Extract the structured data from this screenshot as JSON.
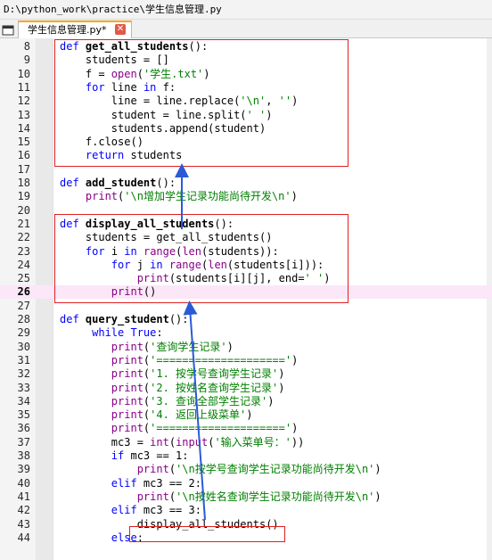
{
  "window": {
    "title": "D:\\python_work\\practice\\学生信息管理.py"
  },
  "tab": {
    "label": "学生信息管理.py*",
    "close_label": "✕"
  },
  "icons": {
    "tab_menu": "window-icon",
    "close": "close-icon"
  },
  "colors": {
    "keyword": "#0000ff",
    "builtin": "#880088",
    "string": "#008000",
    "annotation": "#e02020",
    "arrow": "#2a5bd7"
  },
  "lines": [
    {
      "n": "8",
      "tokens": [
        [
          "kw",
          "def "
        ],
        [
          "fn",
          "get_all_students"
        ],
        [
          "op",
          "():"
        ]
      ]
    },
    {
      "n": "9",
      "tokens": [
        [
          "op",
          "    students = []"
        ]
      ]
    },
    {
      "n": "10",
      "tokens": [
        [
          "op",
          "    f = "
        ],
        [
          "bi",
          "open"
        ],
        [
          "op",
          "("
        ],
        [
          "st",
          "'学生.txt'"
        ],
        [
          "op",
          ")"
        ]
      ]
    },
    {
      "n": "11",
      "tokens": [
        [
          "op",
          "    "
        ],
        [
          "kw",
          "for"
        ],
        [
          "op",
          " line "
        ],
        [
          "kw",
          "in"
        ],
        [
          "op",
          " f:"
        ]
      ]
    },
    {
      "n": "12",
      "tokens": [
        [
          "op",
          "        line = line.replace("
        ],
        [
          "st",
          "'\\n'"
        ],
        [
          "op",
          ", "
        ],
        [
          "st",
          "''"
        ],
        [
          "op",
          ")"
        ]
      ]
    },
    {
      "n": "13",
      "tokens": [
        [
          "op",
          "        student = line.split("
        ],
        [
          "st",
          "' '"
        ],
        [
          "op",
          ")"
        ]
      ]
    },
    {
      "n": "14",
      "tokens": [
        [
          "op",
          "        students.append(student)"
        ]
      ]
    },
    {
      "n": "15",
      "tokens": [
        [
          "op",
          "    f.close()"
        ]
      ]
    },
    {
      "n": "16",
      "tokens": [
        [
          "op",
          "    "
        ],
        [
          "kw",
          "return"
        ],
        [
          "op",
          " students"
        ]
      ]
    },
    {
      "n": "17",
      "tokens": []
    },
    {
      "n": "18",
      "tokens": [
        [
          "kw",
          "def "
        ],
        [
          "fn",
          "add_student"
        ],
        [
          "op",
          "():"
        ]
      ]
    },
    {
      "n": "19",
      "tokens": [
        [
          "op",
          "    "
        ],
        [
          "bi",
          "print"
        ],
        [
          "op",
          "("
        ],
        [
          "st",
          "'\\n增加学生记录功能尚待开发\\n'"
        ],
        [
          "op",
          ")"
        ]
      ]
    },
    {
      "n": "20",
      "tokens": []
    },
    {
      "n": "21",
      "tokens": [
        [
          "kw",
          "def "
        ],
        [
          "fn",
          "display_all_students"
        ],
        [
          "op",
          "():"
        ]
      ]
    },
    {
      "n": "22",
      "tokens": [
        [
          "op",
          "    students = get_all_students()"
        ]
      ]
    },
    {
      "n": "23",
      "tokens": [
        [
          "op",
          "    "
        ],
        [
          "kw",
          "for"
        ],
        [
          "op",
          " i "
        ],
        [
          "kw",
          "in"
        ],
        [
          "op",
          " "
        ],
        [
          "bi",
          "range"
        ],
        [
          "op",
          "("
        ],
        [
          "bi",
          "len"
        ],
        [
          "op",
          "(students)):"
        ]
      ]
    },
    {
      "n": "24",
      "tokens": [
        [
          "op",
          "        "
        ],
        [
          "kw",
          "for"
        ],
        [
          "op",
          " j "
        ],
        [
          "kw",
          "in"
        ],
        [
          "op",
          " "
        ],
        [
          "bi",
          "range"
        ],
        [
          "op",
          "("
        ],
        [
          "bi",
          "len"
        ],
        [
          "op",
          "(students[i])):"
        ]
      ]
    },
    {
      "n": "25",
      "tokens": [
        [
          "op",
          "            "
        ],
        [
          "bi",
          "print"
        ],
        [
          "op",
          "(students[i][j], end="
        ],
        [
          "st",
          "' '"
        ],
        [
          "op",
          ")"
        ]
      ]
    },
    {
      "n": "26",
      "current": true,
      "tokens": [
        [
          "op",
          "        "
        ],
        [
          "bi",
          "print"
        ],
        [
          "op",
          "()"
        ]
      ]
    },
    {
      "n": "27",
      "tokens": []
    },
    {
      "n": "28",
      "tokens": [
        [
          "kw",
          "def "
        ],
        [
          "fn",
          "query_student"
        ],
        [
          "op",
          "():"
        ]
      ]
    },
    {
      "n": "29",
      "tokens": [
        [
          "op",
          "     "
        ],
        [
          "kw",
          "while"
        ],
        [
          "op",
          " "
        ],
        [
          "kw",
          "True"
        ],
        [
          "op",
          ":"
        ]
      ]
    },
    {
      "n": "30",
      "tokens": [
        [
          "op",
          "        "
        ],
        [
          "bi",
          "print"
        ],
        [
          "op",
          "("
        ],
        [
          "st",
          "'查询学生记录'"
        ],
        [
          "op",
          ")"
        ]
      ]
    },
    {
      "n": "31",
      "tokens": [
        [
          "op",
          "        "
        ],
        [
          "bi",
          "print"
        ],
        [
          "op",
          "("
        ],
        [
          "st",
          "'===================='"
        ],
        [
          "op",
          ")"
        ]
      ]
    },
    {
      "n": "32",
      "tokens": [
        [
          "op",
          "        "
        ],
        [
          "bi",
          "print"
        ],
        [
          "op",
          "("
        ],
        [
          "st",
          "'1. 按学号查询学生记录'"
        ],
        [
          "op",
          ")"
        ]
      ]
    },
    {
      "n": "33",
      "tokens": [
        [
          "op",
          "        "
        ],
        [
          "bi",
          "print"
        ],
        [
          "op",
          "("
        ],
        [
          "st",
          "'2. 按姓名查询学生记录'"
        ],
        [
          "op",
          ")"
        ]
      ]
    },
    {
      "n": "34",
      "tokens": [
        [
          "op",
          "        "
        ],
        [
          "bi",
          "print"
        ],
        [
          "op",
          "("
        ],
        [
          "st",
          "'3. 查询全部学生记录'"
        ],
        [
          "op",
          ")"
        ]
      ]
    },
    {
      "n": "35",
      "tokens": [
        [
          "op",
          "        "
        ],
        [
          "bi",
          "print"
        ],
        [
          "op",
          "("
        ],
        [
          "st",
          "'4. 返回上级菜单'"
        ],
        [
          "op",
          ")"
        ]
      ]
    },
    {
      "n": "36",
      "tokens": [
        [
          "op",
          "        "
        ],
        [
          "bi",
          "print"
        ],
        [
          "op",
          "("
        ],
        [
          "st",
          "'===================='"
        ],
        [
          "op",
          ")"
        ]
      ]
    },
    {
      "n": "37",
      "tokens": [
        [
          "op",
          "        mc3 = "
        ],
        [
          "bi",
          "int"
        ],
        [
          "op",
          "("
        ],
        [
          "bi",
          "input"
        ],
        [
          "op",
          "("
        ],
        [
          "st",
          "'输入菜单号：'"
        ],
        [
          "op",
          "))"
        ]
      ]
    },
    {
      "n": "38",
      "tokens": [
        [
          "op",
          "        "
        ],
        [
          "kw",
          "if"
        ],
        [
          "op",
          " mc3 == 1:"
        ]
      ]
    },
    {
      "n": "39",
      "tokens": [
        [
          "op",
          "            "
        ],
        [
          "bi",
          "print"
        ],
        [
          "op",
          "("
        ],
        [
          "st",
          "'\\n按学号查询学生记录功能尚待开发\\n'"
        ],
        [
          "op",
          ")"
        ]
      ]
    },
    {
      "n": "40",
      "tokens": [
        [
          "op",
          "        "
        ],
        [
          "kw",
          "elif"
        ],
        [
          "op",
          " mc3 == 2:"
        ]
      ]
    },
    {
      "n": "41",
      "tokens": [
        [
          "op",
          "            "
        ],
        [
          "bi",
          "print"
        ],
        [
          "op",
          "("
        ],
        [
          "st",
          "'\\n按姓名查询学生记录功能尚待开发\\n'"
        ],
        [
          "op",
          ")"
        ]
      ]
    },
    {
      "n": "42",
      "tokens": [
        [
          "op",
          "        "
        ],
        [
          "kw",
          "elif"
        ],
        [
          "op",
          " mc3 == 3:"
        ]
      ]
    },
    {
      "n": "43",
      "tokens": [
        [
          "op",
          "            display_all_students()"
        ]
      ]
    },
    {
      "n": "44",
      "tokens": [
        [
          "op",
          "        "
        ],
        [
          "kw",
          "else"
        ],
        [
          "op",
          ":"
        ]
      ]
    }
  ]
}
